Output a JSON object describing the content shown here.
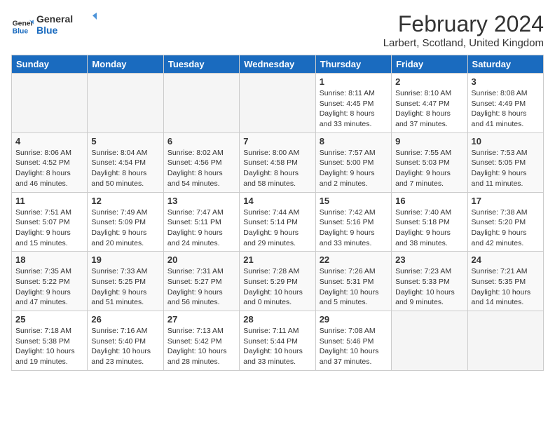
{
  "header": {
    "logo_line1": "General",
    "logo_line2": "Blue",
    "title": "February 2024",
    "subtitle": "Larbert, Scotland, United Kingdom"
  },
  "days_of_week": [
    "Sunday",
    "Monday",
    "Tuesday",
    "Wednesday",
    "Thursday",
    "Friday",
    "Saturday"
  ],
  "weeks": [
    [
      {
        "day": "",
        "info": ""
      },
      {
        "day": "",
        "info": ""
      },
      {
        "day": "",
        "info": ""
      },
      {
        "day": "",
        "info": ""
      },
      {
        "day": "1",
        "info": "Sunrise: 8:11 AM\nSunset: 4:45 PM\nDaylight: 8 hours\nand 33 minutes."
      },
      {
        "day": "2",
        "info": "Sunrise: 8:10 AM\nSunset: 4:47 PM\nDaylight: 8 hours\nand 37 minutes."
      },
      {
        "day": "3",
        "info": "Sunrise: 8:08 AM\nSunset: 4:49 PM\nDaylight: 8 hours\nand 41 minutes."
      }
    ],
    [
      {
        "day": "4",
        "info": "Sunrise: 8:06 AM\nSunset: 4:52 PM\nDaylight: 8 hours\nand 46 minutes."
      },
      {
        "day": "5",
        "info": "Sunrise: 8:04 AM\nSunset: 4:54 PM\nDaylight: 8 hours\nand 50 minutes."
      },
      {
        "day": "6",
        "info": "Sunrise: 8:02 AM\nSunset: 4:56 PM\nDaylight: 8 hours\nand 54 minutes."
      },
      {
        "day": "7",
        "info": "Sunrise: 8:00 AM\nSunset: 4:58 PM\nDaylight: 8 hours\nand 58 minutes."
      },
      {
        "day": "8",
        "info": "Sunrise: 7:57 AM\nSunset: 5:00 PM\nDaylight: 9 hours\nand 2 minutes."
      },
      {
        "day": "9",
        "info": "Sunrise: 7:55 AM\nSunset: 5:03 PM\nDaylight: 9 hours\nand 7 minutes."
      },
      {
        "day": "10",
        "info": "Sunrise: 7:53 AM\nSunset: 5:05 PM\nDaylight: 9 hours\nand 11 minutes."
      }
    ],
    [
      {
        "day": "11",
        "info": "Sunrise: 7:51 AM\nSunset: 5:07 PM\nDaylight: 9 hours\nand 15 minutes."
      },
      {
        "day": "12",
        "info": "Sunrise: 7:49 AM\nSunset: 5:09 PM\nDaylight: 9 hours\nand 20 minutes."
      },
      {
        "day": "13",
        "info": "Sunrise: 7:47 AM\nSunset: 5:11 PM\nDaylight: 9 hours\nand 24 minutes."
      },
      {
        "day": "14",
        "info": "Sunrise: 7:44 AM\nSunset: 5:14 PM\nDaylight: 9 hours\nand 29 minutes."
      },
      {
        "day": "15",
        "info": "Sunrise: 7:42 AM\nSunset: 5:16 PM\nDaylight: 9 hours\nand 33 minutes."
      },
      {
        "day": "16",
        "info": "Sunrise: 7:40 AM\nSunset: 5:18 PM\nDaylight: 9 hours\nand 38 minutes."
      },
      {
        "day": "17",
        "info": "Sunrise: 7:38 AM\nSunset: 5:20 PM\nDaylight: 9 hours\nand 42 minutes."
      }
    ],
    [
      {
        "day": "18",
        "info": "Sunrise: 7:35 AM\nSunset: 5:22 PM\nDaylight: 9 hours\nand 47 minutes."
      },
      {
        "day": "19",
        "info": "Sunrise: 7:33 AM\nSunset: 5:25 PM\nDaylight: 9 hours\nand 51 minutes."
      },
      {
        "day": "20",
        "info": "Sunrise: 7:31 AM\nSunset: 5:27 PM\nDaylight: 9 hours\nand 56 minutes."
      },
      {
        "day": "21",
        "info": "Sunrise: 7:28 AM\nSunset: 5:29 PM\nDaylight: 10 hours\nand 0 minutes."
      },
      {
        "day": "22",
        "info": "Sunrise: 7:26 AM\nSunset: 5:31 PM\nDaylight: 10 hours\nand 5 minutes."
      },
      {
        "day": "23",
        "info": "Sunrise: 7:23 AM\nSunset: 5:33 PM\nDaylight: 10 hours\nand 9 minutes."
      },
      {
        "day": "24",
        "info": "Sunrise: 7:21 AM\nSunset: 5:35 PM\nDaylight: 10 hours\nand 14 minutes."
      }
    ],
    [
      {
        "day": "25",
        "info": "Sunrise: 7:18 AM\nSunset: 5:38 PM\nDaylight: 10 hours\nand 19 minutes."
      },
      {
        "day": "26",
        "info": "Sunrise: 7:16 AM\nSunset: 5:40 PM\nDaylight: 10 hours\nand 23 minutes."
      },
      {
        "day": "27",
        "info": "Sunrise: 7:13 AM\nSunset: 5:42 PM\nDaylight: 10 hours\nand 28 minutes."
      },
      {
        "day": "28",
        "info": "Sunrise: 7:11 AM\nSunset: 5:44 PM\nDaylight: 10 hours\nand 33 minutes."
      },
      {
        "day": "29",
        "info": "Sunrise: 7:08 AM\nSunset: 5:46 PM\nDaylight: 10 hours\nand 37 minutes."
      },
      {
        "day": "",
        "info": ""
      },
      {
        "day": "",
        "info": ""
      }
    ]
  ]
}
